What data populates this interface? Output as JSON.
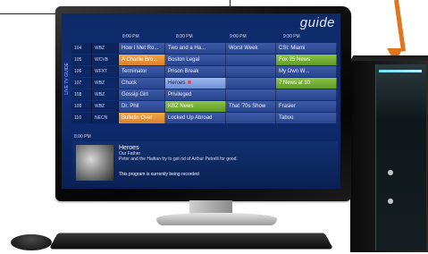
{
  "guide": {
    "title": "guide",
    "times": [
      "8:00 PM",
      "8:30 PM",
      "9:00 PM",
      "9:30 PM"
    ],
    "sidebar_label": "LIVE TV GUIDE",
    "rows": [
      {
        "channel": "104",
        "network": "WBZ",
        "programs": [
          "How I Met Ro...",
          "Two and a Ha...",
          "Worst Week",
          "CSI: Miami"
        ],
        "highlight": [
          null,
          null,
          null,
          null
        ],
        "rec": [
          false,
          false,
          false,
          false
        ]
      },
      {
        "channel": "105",
        "network": "WCVB",
        "programs": [
          "A Charlie Bro...",
          "Boston Legal",
          "",
          ""
        ],
        "highlight": [
          "orange",
          null,
          null,
          "green"
        ],
        "rec": [
          false,
          false,
          false,
          false
        ],
        "extra": "Fox 25 News"
      },
      {
        "channel": "106",
        "network": "WFXT",
        "programs": [
          "Terminator",
          "Prison Break",
          "",
          "My Own W..."
        ],
        "highlight": [
          null,
          null,
          null,
          null
        ],
        "rec": [
          false,
          false,
          false,
          false
        ]
      },
      {
        "channel": "107",
        "network": "WBZ",
        "programs": [
          "Chuck",
          "Heroes",
          "",
          "7 News at 10"
        ],
        "highlight": [
          null,
          "lightblue",
          null,
          "green"
        ],
        "rec": [
          false,
          true,
          false,
          false
        ]
      },
      {
        "channel": "108",
        "network": "WBZ",
        "programs": [
          "Gossip Girl",
          "Privileged",
          "",
          ""
        ],
        "highlight": [
          null,
          null,
          null,
          null
        ],
        "rec": [
          false,
          false,
          false,
          false
        ]
      },
      {
        "channel": "109",
        "network": "WBZ",
        "programs": [
          "Dr. Phil",
          "KBZ News",
          "That '70s Show",
          "Frasier"
        ],
        "highlight": [
          null,
          "green",
          null,
          null
        ],
        "rec": [
          false,
          false,
          false,
          false
        ]
      },
      {
        "channel": "110",
        "network": "NECN",
        "programs": [
          "Bulletin Over",
          "Locked Up Abroad",
          "",
          "Taboo"
        ],
        "highlight": [
          "orange",
          null,
          null,
          null
        ],
        "rec": [
          false,
          false,
          false,
          false
        ]
      }
    ],
    "detail": {
      "time": "8:00 PM",
      "title": "Heroes",
      "episode": "Our Father",
      "synopsis": "Peter and the Haitian try to get rid of Arthur Petrelli for good.",
      "status": "This program is currently being recorded"
    }
  },
  "colors": {
    "arrow": "#e0751f",
    "highlight_orange": "#f2a64a",
    "highlight_green": "#8ec547",
    "highlight_lightblue": "#9fb8ee",
    "screen_bg": "#102f78"
  }
}
